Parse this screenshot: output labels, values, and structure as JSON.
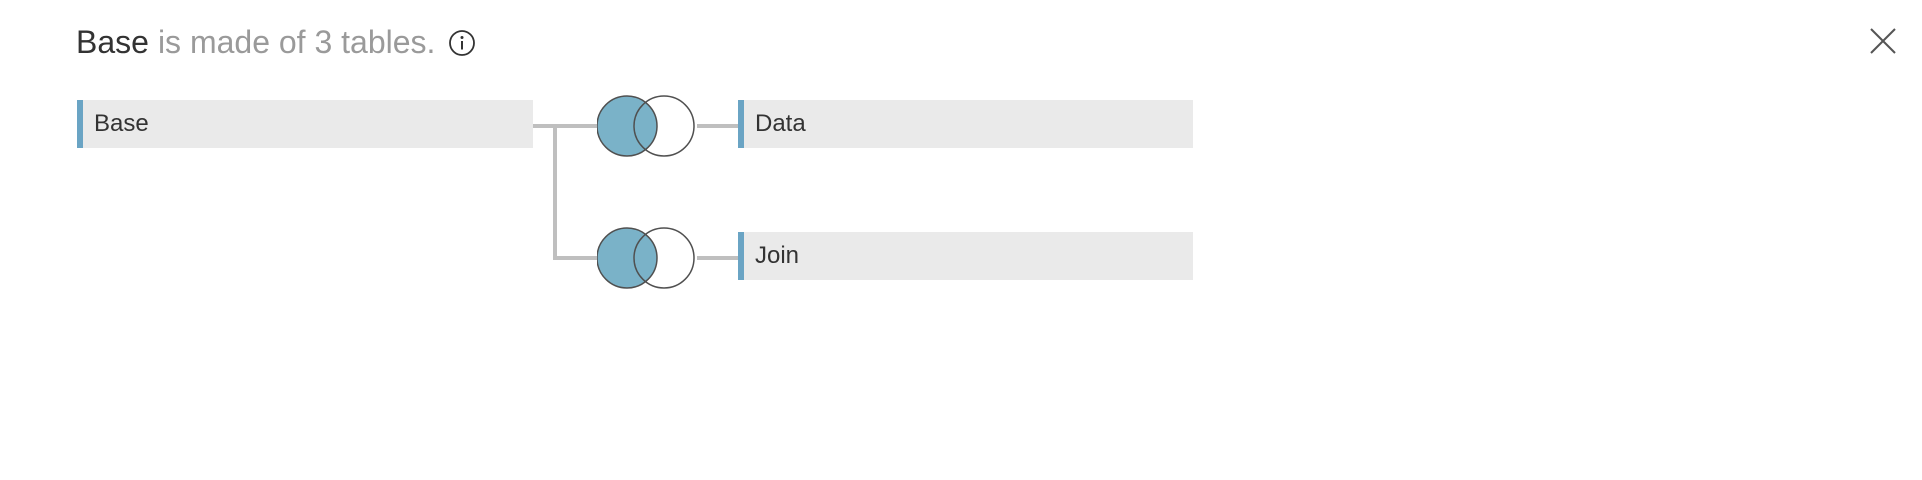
{
  "header": {
    "table_name": "Base",
    "description": "is made of 3 tables.",
    "info_icon": "info-icon"
  },
  "close_icon": "close-icon",
  "tables": {
    "base": "Base",
    "data": "Data",
    "join": "Join"
  },
  "joins": [
    {
      "type": "left",
      "icon": "left-join-venn-icon"
    },
    {
      "type": "left",
      "icon": "left-join-venn-icon"
    }
  ],
  "colors": {
    "accent": "#6aa4c4",
    "venn_fill": "#7ab2c8",
    "line": "#bfbfbf",
    "box_bg": "#eaeaea"
  }
}
